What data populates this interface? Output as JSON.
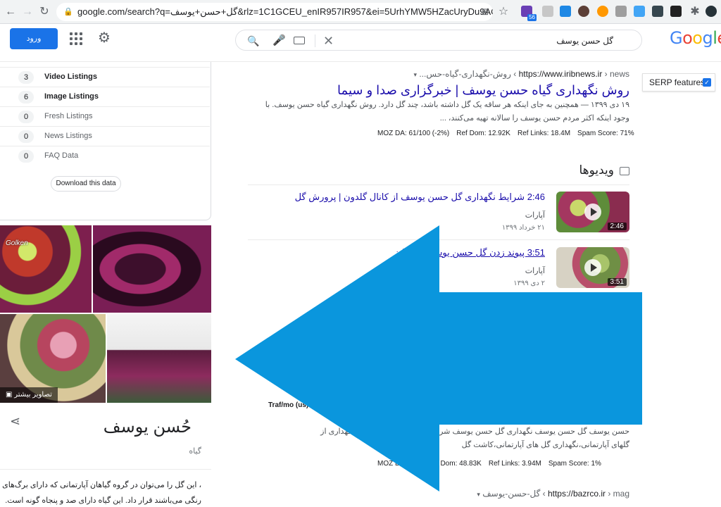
{
  "browser": {
    "url": "google.com/search?q=گل+حسن+یوسف&rlz=1C1GCEU_enIR957IR957&ei=5UrhYMW5HZacUryDu9AC&gs_ss...",
    "ext_badge_1": "56"
  },
  "header": {
    "login_label": "ورود",
    "query": "گل حسن یوسف",
    "logo": [
      "G",
      "o",
      "o",
      "g",
      "l",
      "e"
    ]
  },
  "stats": [
    {
      "count": "3",
      "label": "Video Listings",
      "style": "bold"
    },
    {
      "count": "6",
      "label": "Image Listings",
      "style": "bold"
    },
    {
      "count": "0",
      "label": "Fresh Listings",
      "style": "light"
    },
    {
      "count": "0",
      "label": "News Listings",
      "style": "light"
    },
    {
      "count": "0",
      "label": "FAQ Data",
      "style": "light"
    }
  ],
  "download_label": "Download this data",
  "images": {
    "more_label": "تصاویر بیشتر",
    "watermark": "Golken"
  },
  "knowledge_panel": {
    "title": "حُسن یوسف",
    "subtitle": "گیاه",
    "description": "، این گل را می‌توان در گروه گیاهان آپارتمانی که دارای برگ‌های رنگی می‌باشند قرار داد. این گیاه دارای صد و پنجاه گونه است. ارتفاع این"
  },
  "serp_features_label": "SERP features",
  "result1": {
    "domain": "https://www.iribnews.ir",
    "path": " › news › روش-نگهداری-گیاه-حس...",
    "title": "روش نگهداری گیاه حسن یوسف | خبرگزاری صدا و سیما",
    "snippet": "۱۹ دی ۱۳۹۹ — همچنین به جای اینکه هر ساقه یک گل داشته باشد، چند گل دارد. روش نگهداری گیاه حسن یوسف. با وجود اینکه اکثر مردم حسن یوسف را سالانه تهیه می‌کنند، ...",
    "moz": [
      "MOZ DA: 61/100 (-2%)",
      "Ref Dom: 12.92K",
      "Ref Links: 18.4M",
      "Spam Score: 71%"
    ]
  },
  "videos": {
    "heading": "ویدیوها",
    "items": [
      {
        "title": "2:46 شرایط نگهداری گل حسن یوسف از کانال گلدون | پرورش گل",
        "source": "آپارات",
        "date": "۲۱ خرداد ۱۳۹۹",
        "duration": "2:46"
      },
      {
        "title": "3:51 پیوند زدن گل حسن یوسف ... آنالیز",
        "source": "آپارات",
        "date": "۲ دی ۱۳۹۹",
        "duration": "3:51"
      }
    ]
  },
  "result2": {
    "traffic": "Traf/mo (us)",
    "snippet_line1": "حسن یوسف گل حسن یوسف نگهداری گل حسن یوسف شرایط نگهداری حسن یوسف،نگهداری از",
    "snippet_line2": "گلهای آپارتمانی،نگهداری گل های آپارتمانی،کاشت گل",
    "moz": [
      "MOZ DA",
      "%)",
      "Ref Dom: 48.83K",
      "Ref Links: 3.94M",
      "Spam Score: 1%"
    ]
  },
  "result3": {
    "domain": "https://bazrco.ir",
    "path": " › mag › گل-حسن-یوسف"
  }
}
